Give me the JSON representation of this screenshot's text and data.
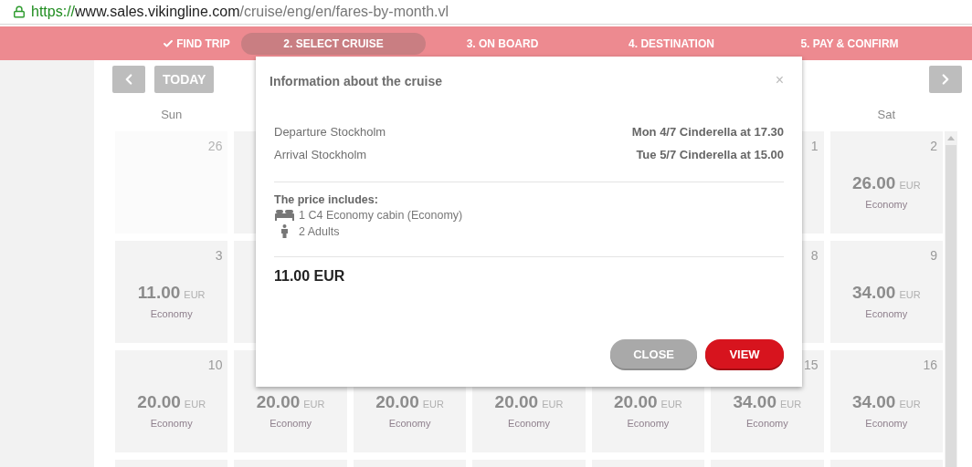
{
  "address_bar": {
    "scheme": "https://",
    "host": "www.sales.vikingline.com",
    "path": "/cruise/eng/en/fares-by-month.vl"
  },
  "steps": [
    {
      "label": "FIND TRIP",
      "done": true,
      "selected": false
    },
    {
      "label": "2. SELECT CRUISE",
      "done": false,
      "selected": true
    },
    {
      "label": "3. ON BOARD",
      "done": false,
      "selected": false
    },
    {
      "label": "4. DESTINATION",
      "done": false,
      "selected": false
    },
    {
      "label": "5. PAY & CONFIRM",
      "done": false,
      "selected": false
    }
  ],
  "calendar": {
    "today_button": "TODAY",
    "weekdays": {
      "sun": "Sun",
      "sat": "Sat"
    },
    "weeks": [
      {
        "sun": {
          "outside_month": true,
          "date": "26"
        },
        "fri": {
          "date": "1"
        },
        "sat": {
          "date": "2",
          "price": "26.00",
          "currency": "EUR",
          "class": "Economy"
        }
      },
      {
        "sun": {
          "date": "3",
          "price": "11.00",
          "currency": "EUR",
          "class": "Economy"
        },
        "fri": {
          "date": "8"
        },
        "sat": {
          "date": "9",
          "price": "34.00",
          "currency": "EUR",
          "class": "Economy"
        }
      },
      {
        "sun": {
          "date": "10",
          "price": "20.00",
          "currency": "EUR",
          "class": "Economy"
        },
        "mon": {
          "price": "20.00",
          "currency": "EUR",
          "class": "Economy"
        },
        "tue": {
          "price": "20.00",
          "currency": "EUR",
          "class": "Economy"
        },
        "wed": {
          "price": "20.00",
          "currency": "EUR",
          "class": "Economy"
        },
        "thu": {
          "price": "20.00",
          "currency": "EUR",
          "class": "Economy"
        },
        "fri": {
          "date": "15",
          "price": "34.00",
          "currency": "EUR",
          "class": "Economy"
        },
        "sat": {
          "date": "16",
          "price": "34.00",
          "currency": "EUR",
          "class": "Economy"
        }
      }
    ]
  },
  "dialog": {
    "title": "Information about the cruise",
    "close_glyph": "×",
    "rows": [
      {
        "label": "Departure Stockholm",
        "value": "Mon 4/7 Cinderella at 17.30"
      },
      {
        "label": "Arrival Stockholm",
        "value": "Tue 5/7 Cinderella at 15.00"
      }
    ],
    "includes_title": "The price includes:",
    "includes": [
      {
        "kind": "cabin",
        "text": "1 C4 Economy cabin (Economy)"
      },
      {
        "kind": "person",
        "text": "2 Adults"
      }
    ],
    "total": "11.00 EUR",
    "buttons": [
      {
        "kind": "secondary",
        "label": "CLOSE"
      },
      {
        "kind": "primary",
        "label": "VIEW"
      }
    ]
  }
}
